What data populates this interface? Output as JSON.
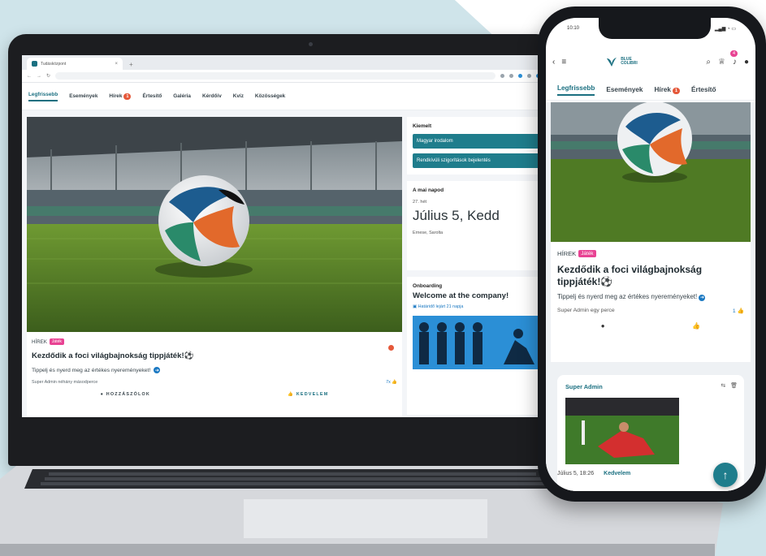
{
  "colors": {
    "accent": "#1a6f80",
    "badge": "#e5583a",
    "pink": "#e84393",
    "link": "#1a78c2",
    "teal_button": "#1f7d8c"
  },
  "browser": {
    "tab_title": "Tudásközpont",
    "new_tab_icon": "plus-icon"
  },
  "desktop": {
    "nav": [
      {
        "label": "Legfrissebb",
        "active": true
      },
      {
        "label": "Események"
      },
      {
        "label": "Hírek",
        "badge": "1"
      },
      {
        "label": "Értesítő"
      },
      {
        "label": "Galéria"
      },
      {
        "label": "Kérdőív"
      },
      {
        "label": "Kvíz"
      },
      {
        "label": "Közösségek"
      }
    ],
    "post": {
      "kicker": "HÍREK",
      "tag": "Játék",
      "title": "Kezdődik a foci világbajnokság tippjáték!⚽",
      "text": "Tippelj és nyerd meg az értékes nyereményeket!",
      "author": "Super Admin",
      "time": "néhány másodperce",
      "likes": "7x",
      "comment_label": "HOZZÁSZÓLOK",
      "like_label": "KEDVELEM"
    },
    "sidebar": {
      "featured_title": "Kiemelt",
      "featured_items": [
        "Magyar irodalom",
        "Rendkívüli szigorítások bejelentés"
      ],
      "today_title": "A mai napod",
      "week": "27. hét",
      "date": "Július 5, Kedd",
      "namedays": "Ernese, Sarolta",
      "onboarding_label": "Onboarding",
      "onboarding_title": "Welcome at the company!",
      "deadline": "Határidő lejárt 21 napja"
    }
  },
  "phone": {
    "time": "10:10",
    "status": "▂▄▆ ◔ ▭",
    "logo_line1": "BLUE",
    "logo_line2": "COLIBRI",
    "notifications": "4",
    "tabs": [
      {
        "label": "Legfrissebb",
        "active": true
      },
      {
        "label": "Események"
      },
      {
        "label": "Hírek",
        "badge": "1"
      },
      {
        "label": "Értesítő"
      }
    ],
    "post": {
      "kicker": "HÍREK",
      "tag": "Játék",
      "title": "Kezdődik a foci világbajnokság tippjáték!⚽",
      "text": "Tippelj és nyerd meg az értékes nyereményeket!",
      "author": "Super Admin",
      "time": "egy perce",
      "likes": "1"
    },
    "second_post": {
      "author": "Super Admin",
      "datetime": "Július 5, 18:26",
      "like_label": "Kedvelem"
    }
  }
}
